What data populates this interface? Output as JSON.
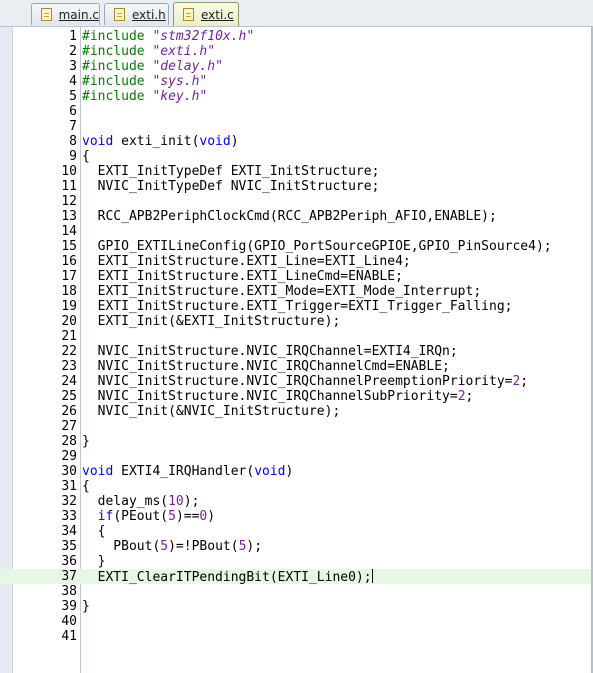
{
  "tabs": [
    {
      "label": "main.c",
      "active": false
    },
    {
      "label": "exti.h",
      "active": false
    },
    {
      "label": "exti.c",
      "active": true
    }
  ],
  "colors": {
    "preprocessor": "#008000",
    "string": "#7a1fa8",
    "keyword": "#0000ff",
    "number": "#7a1fa8",
    "current_line": "#e6f8e3"
  },
  "editor": {
    "current_line": 37,
    "lines": [
      {
        "n": "1",
        "tokens": [
          {
            "t": "#include ",
            "c": "pp"
          },
          {
            "t": "\"stm32f10x.h\"",
            "c": "str"
          }
        ]
      },
      {
        "n": "2",
        "tokens": [
          {
            "t": "#include ",
            "c": "pp"
          },
          {
            "t": "\"exti.h\"",
            "c": "str"
          }
        ]
      },
      {
        "n": "3",
        "tokens": [
          {
            "t": "#include ",
            "c": "pp"
          },
          {
            "t": "\"delay.h\"",
            "c": "str"
          }
        ]
      },
      {
        "n": "4",
        "tokens": [
          {
            "t": "#include ",
            "c": "pp"
          },
          {
            "t": "\"sys.h\"",
            "c": "str"
          }
        ]
      },
      {
        "n": "5",
        "tokens": [
          {
            "t": "#include ",
            "c": "pp"
          },
          {
            "t": "\"key.h\"",
            "c": "str"
          }
        ]
      },
      {
        "n": "6",
        "tokens": []
      },
      {
        "n": "7",
        "tokens": []
      },
      {
        "n": "8",
        "tokens": [
          {
            "t": "void",
            "c": "kw"
          },
          {
            "t": " exti_init(",
            "c": "id"
          },
          {
            "t": "void",
            "c": "kw"
          },
          {
            "t": ")",
            "c": "id"
          }
        ]
      },
      {
        "n": "9",
        "tokens": [
          {
            "t": "{",
            "c": "id"
          }
        ]
      },
      {
        "n": "10",
        "tokens": [
          {
            "t": "  EXTI_InitTypeDef EXTI_InitStructure;",
            "c": "id"
          }
        ]
      },
      {
        "n": "11",
        "tokens": [
          {
            "t": "  NVIC_InitTypeDef NVIC_InitStructure;",
            "c": "id"
          }
        ]
      },
      {
        "n": "12",
        "tokens": []
      },
      {
        "n": "13",
        "tokens": [
          {
            "t": "  RCC_APB2PeriphClockCmd(RCC_APB2Periph_AFIO,ENABLE);",
            "c": "id"
          }
        ]
      },
      {
        "n": "14",
        "tokens": []
      },
      {
        "n": "15",
        "tokens": [
          {
            "t": "  GPIO_EXTILineConfig(GPIO_PortSourceGPIOE,GPIO_PinSource4);",
            "c": "id"
          }
        ]
      },
      {
        "n": "16",
        "tokens": [
          {
            "t": "  EXTI_InitStructure.EXTI_Line=EXTI_Line4;",
            "c": "id"
          }
        ]
      },
      {
        "n": "17",
        "tokens": [
          {
            "t": "  EXTI_InitStructure.EXTI_LineCmd=ENABLE;",
            "c": "id"
          }
        ]
      },
      {
        "n": "18",
        "tokens": [
          {
            "t": "  EXTI_InitStructure.EXTI_Mode=EXTI_Mode_Interrupt;",
            "c": "id"
          }
        ]
      },
      {
        "n": "19",
        "tokens": [
          {
            "t": "  EXTI_InitStructure.EXTI_Trigger=EXTI_Trigger_Falling;",
            "c": "id"
          }
        ]
      },
      {
        "n": "20",
        "tokens": [
          {
            "t": "  EXTI_Init(&EXTI_InitStructure);",
            "c": "id"
          }
        ]
      },
      {
        "n": "21",
        "tokens": []
      },
      {
        "n": "22",
        "tokens": [
          {
            "t": "  NVIC_InitStructure.NVIC_IRQChannel=EXTI4_IRQn;",
            "c": "id"
          }
        ]
      },
      {
        "n": "23",
        "tokens": [
          {
            "t": "  NVIC_InitStructure.NVIC_IRQChannelCmd=ENABLE;",
            "c": "id"
          }
        ]
      },
      {
        "n": "24",
        "tokens": [
          {
            "t": "  NVIC_InitStructure.NVIC_IRQChannelPreemptionPriority=",
            "c": "id"
          },
          {
            "t": "2",
            "c": "num"
          },
          {
            "t": ";",
            "c": "id"
          }
        ]
      },
      {
        "n": "25",
        "tokens": [
          {
            "t": "  NVIC_InitStructure.NVIC_IRQChannelSubPriority=",
            "c": "id"
          },
          {
            "t": "2",
            "c": "num"
          },
          {
            "t": ";",
            "c": "id"
          }
        ]
      },
      {
        "n": "26",
        "tokens": [
          {
            "t": "  NVIC_Init(&NVIC_InitStructure);",
            "c": "id"
          }
        ]
      },
      {
        "n": "27",
        "tokens": []
      },
      {
        "n": "28",
        "tokens": [
          {
            "t": "}",
            "c": "id"
          }
        ]
      },
      {
        "n": "29",
        "tokens": []
      },
      {
        "n": "30",
        "tokens": [
          {
            "t": "void",
            "c": "kw"
          },
          {
            "t": " EXTI4_IRQHandler(",
            "c": "id"
          },
          {
            "t": "void",
            "c": "kw"
          },
          {
            "t": ")",
            "c": "id"
          }
        ]
      },
      {
        "n": "31",
        "tokens": [
          {
            "t": "{",
            "c": "id"
          }
        ]
      },
      {
        "n": "32",
        "tokens": [
          {
            "t": "  delay_ms(",
            "c": "id"
          },
          {
            "t": "10",
            "c": "num"
          },
          {
            "t": ");",
            "c": "id"
          }
        ]
      },
      {
        "n": "33",
        "tokens": [
          {
            "t": "  ",
            "c": "id"
          },
          {
            "t": "if",
            "c": "kw"
          },
          {
            "t": "(PEout(",
            "c": "id"
          },
          {
            "t": "5",
            "c": "num"
          },
          {
            "t": ")==",
            "c": "id"
          },
          {
            "t": "0",
            "c": "num"
          },
          {
            "t": ")",
            "c": "id"
          }
        ]
      },
      {
        "n": "34",
        "tokens": [
          {
            "t": "  {",
            "c": "id"
          }
        ]
      },
      {
        "n": "35",
        "tokens": [
          {
            "t": "    PBout(",
            "c": "id"
          },
          {
            "t": "5",
            "c": "num"
          },
          {
            "t": ")=!PBout(",
            "c": "id"
          },
          {
            "t": "5",
            "c": "num"
          },
          {
            "t": ");",
            "c": "id"
          }
        ]
      },
      {
        "n": "36",
        "tokens": [
          {
            "t": "  }",
            "c": "id"
          }
        ]
      },
      {
        "n": "37",
        "tokens": [
          {
            "t": "  EXTI_ClearITPendingBit(EXTI_Line0);",
            "c": "id"
          }
        ]
      },
      {
        "n": "38",
        "tokens": []
      },
      {
        "n": "39",
        "tokens": [
          {
            "t": "}",
            "c": "id"
          }
        ]
      },
      {
        "n": "40",
        "tokens": []
      },
      {
        "n": "41",
        "tokens": []
      }
    ]
  }
}
